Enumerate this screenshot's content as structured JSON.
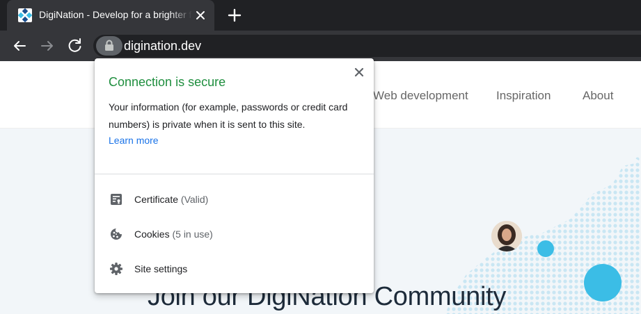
{
  "browser": {
    "tab": {
      "title": "DigiNation - Develop for a brighter future"
    },
    "address_bar": {
      "url": "digination.dev"
    }
  },
  "website": {
    "nav": [
      "Web development",
      "Inspiration",
      "About"
    ],
    "hero_title": "Join our DigiNation Community"
  },
  "popup": {
    "heading": "Connection is secure",
    "description": "Your information (for example, passwords or credit card numbers) is private when it is sent to this site.",
    "learn_more": "Learn more",
    "items": [
      {
        "label": "Certificate",
        "sub": "(Valid)",
        "icon": "certificate-icon"
      },
      {
        "label": "Cookies",
        "sub": "(5 in use)",
        "icon": "cookie-icon"
      },
      {
        "label": "Site settings",
        "sub": "",
        "icon": "gear-icon"
      }
    ]
  },
  "colors": {
    "chrome_dark": "#202124",
    "chrome_toolbar": "#35363a",
    "secure_green": "#1e8e3e",
    "link_blue": "#1a73e8",
    "accent_cyan": "#3bbde6"
  }
}
